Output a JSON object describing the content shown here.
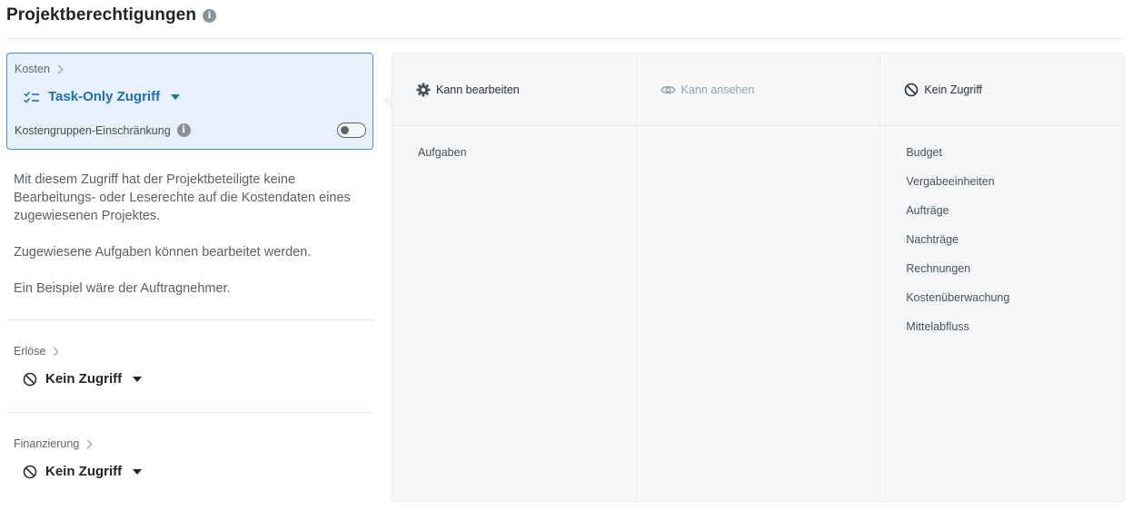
{
  "page": {
    "title": "Projektberechtigungen"
  },
  "kosten": {
    "section_label": "Kosten",
    "selected_access": "Task-Only Zugriff",
    "restriction_label": "Kostengruppen-Einschränkung",
    "restriction_enabled": false,
    "description": [
      "Mit diesem Zugriff hat der Projektbeteiligte keine Bearbeitungs- oder Leserechte auf die Kostendaten eines zugewiesenen Projektes.",
      "Zugewiesene Aufgaben können bearbeitet werden.",
      "Ein Beispiel wäre der Auftragnehmer."
    ]
  },
  "erloese": {
    "section_label": "Erlöse",
    "selected_access": "Kein Zugriff"
  },
  "finanzierung": {
    "section_label": "Finanzierung",
    "selected_access": "Kein Zugriff"
  },
  "permissions": {
    "columns": [
      {
        "header": "Kann bearbeiten",
        "icon": "gear-icon",
        "items": [
          "Aufgaben"
        ]
      },
      {
        "header": "Kann ansehen",
        "icon": "eye-icon",
        "items": []
      },
      {
        "header": "Kein Zugriff",
        "icon": "no-access-icon",
        "items": [
          "Budget",
          "Vergabeeinheiten",
          "Aufträge",
          "Nachträge",
          "Rechnungen",
          "Kostenüberwachung",
          "Mittelabfluss"
        ]
      }
    ]
  },
  "colors": {
    "accent": "#1f6fb5",
    "selected_bg": "#e7f1fb",
    "selected_border": "#4d8fd0"
  }
}
